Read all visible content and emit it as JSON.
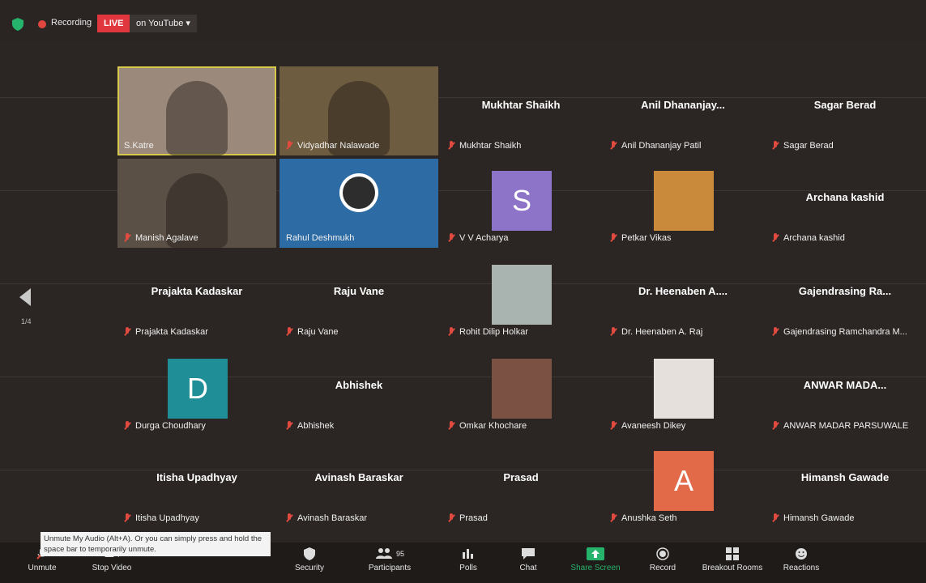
{
  "top_bar": {
    "recording_label": "Recording",
    "live_label": "LIVE",
    "youtube_label": "on YouTube",
    "youtube_caret": "▾"
  },
  "gallery": {
    "page_indicator": "1/4",
    "tiles": [
      {
        "kind": "video",
        "display_name": "",
        "tag": "S.Katre",
        "bg": "#9b8a7c"
      },
      {
        "kind": "video",
        "display_name": "",
        "tag": "Vidyadhar Nalawade",
        "bg": "#6d5c3f"
      },
      {
        "kind": "name",
        "display_name": "Mukhtar Shaikh",
        "tag": "Mukhtar Shaikh"
      },
      {
        "kind": "name",
        "display_name": "Anil  Dhananjay...",
        "tag": "Anil Dhananjay Patil"
      },
      {
        "kind": "name",
        "display_name": "Sagar Berad",
        "tag": "Sagar Berad"
      },
      {
        "kind": "video",
        "display_name": "",
        "tag": "Manish Agalave",
        "bg": "#5b5046"
      },
      {
        "kind": "logo",
        "display_name": "",
        "tag": "Rahul Deshmukh",
        "bg": "#2d6ba5"
      },
      {
        "kind": "avatar",
        "display_name": "",
        "tag": "V V Acharya",
        "letter": "S",
        "bg": "#8d74c8"
      },
      {
        "kind": "thumb",
        "display_name": "",
        "tag": "Petkar Vikas",
        "bg": "#c98a3c"
      },
      {
        "kind": "name",
        "display_name": "Archana kashid",
        "tag": "Archana kashid"
      },
      {
        "kind": "name",
        "display_name": "Prajakta Kadaskar",
        "tag": "Prajakta Kadaskar"
      },
      {
        "kind": "name",
        "display_name": "Raju Vane",
        "tag": "Raju Vane"
      },
      {
        "kind": "thumb",
        "display_name": "",
        "tag": "Rohit Dilip Holkar",
        "bg": "#a9b4b0"
      },
      {
        "kind": "name",
        "display_name": "Dr. Heenaben A....",
        "tag": "Dr. Heenaben A. Raj"
      },
      {
        "kind": "name",
        "display_name": "Gajendrasing  Ra...",
        "tag": "Gajendrasing Ramchandra M..."
      },
      {
        "kind": "avatar",
        "display_name": "",
        "tag": "Durga Choudhary",
        "letter": "D",
        "bg": "#1f8e96"
      },
      {
        "kind": "name",
        "display_name": "Abhishek",
        "tag": "Abhishek"
      },
      {
        "kind": "thumb",
        "display_name": "",
        "tag": "Omkar Khochare",
        "bg": "#7a5142"
      },
      {
        "kind": "thumb",
        "display_name": "",
        "tag": "Avaneesh Dikey",
        "bg": "#e6e0dc"
      },
      {
        "kind": "name",
        "display_name": "ANWAR MADA...",
        "tag": "ANWAR MADAR PARSUWALE"
      },
      {
        "kind": "name",
        "display_name": "Itisha Upadhyay",
        "tag": "Itisha Upadhyay"
      },
      {
        "kind": "name",
        "display_name": "Avinash Baraskar",
        "tag": "Avinash Baraskar"
      },
      {
        "kind": "name",
        "display_name": "Prasad",
        "tag": "Prasad"
      },
      {
        "kind": "avatar",
        "display_name": "",
        "tag": "Anushka Seth",
        "letter": "A",
        "bg": "#e36a49"
      },
      {
        "kind": "name",
        "display_name": "Himansh Gawade",
        "tag": "Himansh Gawade"
      }
    ]
  },
  "tooltip": {
    "text": "Unmute My Audio (Alt+A). Or you can simply press and hold the space bar to temporarily unmute."
  },
  "toolbar": {
    "unmute": "Unmute",
    "stop_video": "Stop Video",
    "security": "Security",
    "participants": "Participants",
    "participants_count": "95",
    "polls": "Polls",
    "chat": "Chat",
    "share_screen": "Share Screen",
    "record": "Record",
    "breakout_rooms": "Breakout Rooms",
    "reactions": "Reactions"
  },
  "colors": {
    "background": "#2b2624",
    "live": "#e0373f",
    "muted_mic": "#e14a3f",
    "share_screen": "#26b36c",
    "speaker_border": "#d6c84a"
  }
}
